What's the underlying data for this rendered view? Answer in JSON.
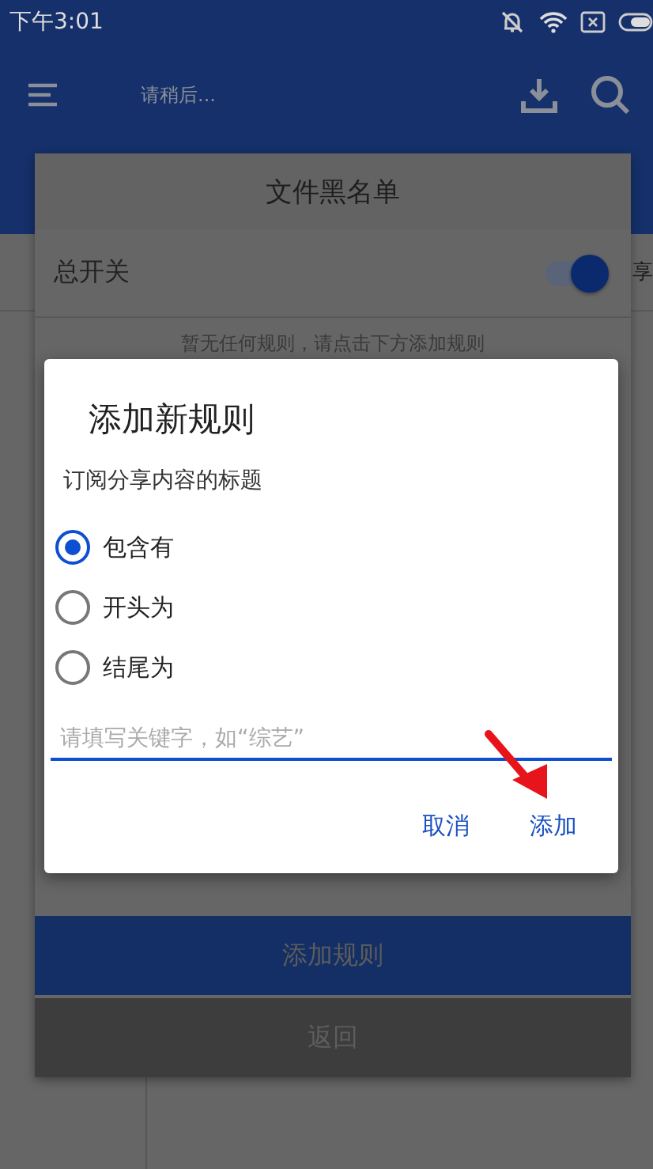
{
  "status_bar": {
    "time": "下午3:01"
  },
  "app_bar": {
    "title": "请稍后..."
  },
  "background": {
    "partial_text": "享"
  },
  "panel": {
    "title": "文件黑名单",
    "master_switch": {
      "label": "总开关",
      "on": true
    },
    "empty_hint": "暂无任何规则，请点击下方添加规则",
    "buttons": [
      {
        "label": "添加规则",
        "kind": "primary"
      },
      {
        "label": "返回",
        "kind": "secondary"
      }
    ]
  },
  "dialog": {
    "title": "添加新规则",
    "subtitle": "订阅分享内容的标题",
    "options": [
      {
        "label": "包含有",
        "selected": true
      },
      {
        "label": "开头为",
        "selected": false
      },
      {
        "label": "结尾为",
        "selected": false
      }
    ],
    "input": {
      "placeholder": "请填写关键字，如“综艺”"
    },
    "buttons": [
      "取消",
      "添加"
    ]
  }
}
